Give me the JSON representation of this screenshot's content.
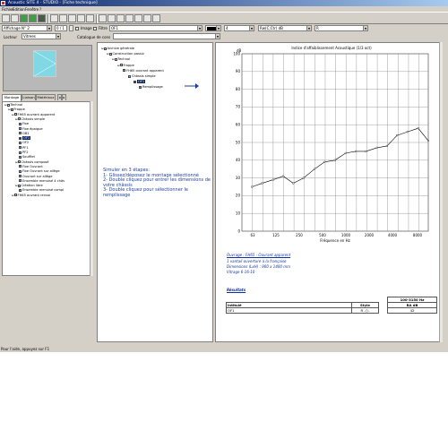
{
  "window": {
    "title": "Acoustic SITE 4 - STUDIO - [Fiche technique]"
  },
  "menu": [
    "Fichier",
    "Edition",
    "Fenêtre",
    "?"
  ],
  "toolbar": {
    "affichage_value": "Affichage N° 2",
    "counter": "0 / 1",
    "image_label": "Image",
    "filtre_label": "Filtre",
    "filtre_value": "OF1",
    "color_value": "",
    "width_value": "4",
    "rw_value": "Rw(C;Ctr) dB",
    "r_value": "R",
    "locator_label": "Locteur",
    "locator_value": "Vitrees",
    "catalogue_label": "Catalogue de cons"
  },
  "left": {
    "tabs": [
      "Montage",
      "Liaison",
      "Matériaux"
    ],
    "tree": [
      {
        "label": "Technal",
        "level": 0
      },
      {
        "label": "Frappe",
        "level": 1
      },
      {
        "label": "FH65 ouvrant apparent",
        "level": 2
      },
      {
        "label": "Châssis simple",
        "level": 3
      },
      {
        "label": "Fixe",
        "level": 4
      },
      {
        "label": "Fixe épaigue",
        "level": 4
      },
      {
        "label": "OB1",
        "level": 4
      },
      {
        "label": "OF1",
        "level": 4,
        "selected": true
      },
      {
        "label": "OF2",
        "level": 4
      },
      {
        "label": "PF1",
        "level": 4
      },
      {
        "label": "PF2",
        "level": 4
      },
      {
        "label": "Soufflet",
        "level": 4
      },
      {
        "label": "Châssis composé",
        "level": 3
      },
      {
        "label": "Fixe Ouvrant",
        "level": 4
      },
      {
        "label": "Fixe Ouvrant sur allège",
        "level": 4
      },
      {
        "label": "Ouvrant sur allège",
        "level": 4
      },
      {
        "label": "Ensemble menuisé 4 châs",
        "level": 4
      },
      {
        "label": "Création libre",
        "level": 3
      },
      {
        "label": "Ensemble menuisé compl",
        "level": 4
      },
      {
        "label": "FH65 ouvrant renvoi",
        "level": 2
      }
    ]
  },
  "middle": {
    "tree": [
      {
        "label": "Archive générale",
        "level": 0
      },
      {
        "label": "Construction passiv",
        "level": 1
      },
      {
        "label": "Technal",
        "level": 2
      },
      {
        "label": "Frappe",
        "level": 3
      },
      {
        "label": "FH65 ouvrant apparent",
        "level": 4
      },
      {
        "label": "Châssis simple",
        "level": 5
      },
      {
        "label": "OF1",
        "level": 6,
        "selected": true
      },
      {
        "label": "Remplissage",
        "level": 7
      }
    ],
    "instructions": "Simuler en 3 étapes:\n1- Glissez/déposez le montage sélectionné\n2- Double cliquez pour entrer les dimensions de votre châssis\n3- Double cliquez pour sélectionner le remplissage"
  },
  "chart_data": {
    "type": "line",
    "title": "Indice d'affaiblissement Acoustique (1/3 oct)",
    "ylabel": "dB",
    "xlabel": "Fréquence en Hz",
    "ylim": [
      0,
      100
    ],
    "yticks": [
      0,
      10,
      20,
      30,
      40,
      50,
      60,
      70,
      80,
      90,
      100
    ],
    "xticks": [
      "63",
      "125",
      "250",
      "500",
      "1000",
      "2000",
      "4000",
      "8000"
    ],
    "x": [
      100,
      125,
      160,
      200,
      250,
      315,
      400,
      500,
      630,
      800,
      1000,
      1250,
      1600,
      2000,
      2500,
      3150,
      4000,
      5000
    ],
    "series": [
      {
        "values": [
          25,
          27,
          29,
          31,
          27,
          30,
          35,
          39,
          40,
          44,
          45,
          45,
          47,
          48,
          54,
          56,
          58,
          51
        ]
      }
    ],
    "grid": true,
    "log_x": true
  },
  "report": {
    "ouvrage": "Ouvrage : FH65 - Ouvrant apparent",
    "line1": "1 vantail ouverture à la française",
    "line2": "Dimensions (LxH) : 900 x 1400 mm",
    "line3": "Vitrage 6-16-10",
    "resultats": "Résultats",
    "table": {
      "band": "100-3150 Hz",
      "headers": [
        "Intitulé",
        "Style",
        "RA dB"
      ],
      "row": {
        "intitule": "OF1",
        "style": "R",
        "ra": "42"
      }
    }
  },
  "status": "Pour l'aide, appuyez sur F1",
  "colors": {
    "chrome": "#d4d0c8",
    "title_start": "#0a246a",
    "instructions": "#2040a0",
    "selection": "#0a246a",
    "preview_glass": "#7fd8e4"
  }
}
